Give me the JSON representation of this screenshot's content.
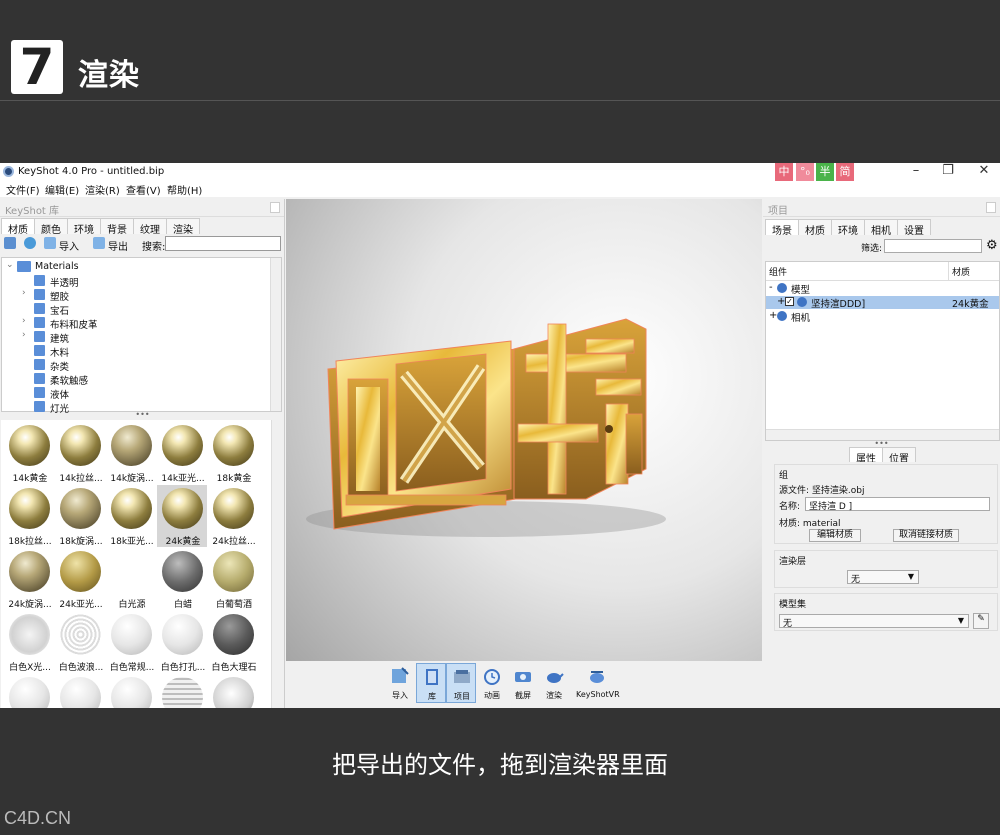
{
  "slide": {
    "step_number": "7",
    "step_title": "渲染",
    "caption": "把导出的文件，拖到渲染器里面",
    "watermark": "C4D.CN"
  },
  "app": {
    "title": "KeyShot 4.0 Pro  - untitled.bip",
    "lang_buttons": [
      "中",
      "°₀",
      "半",
      "简"
    ],
    "lang_colors": [
      "#e8697a",
      "#f08b9b",
      "#4ab34a",
      "#e8697a"
    ],
    "menu": [
      "文件(F)",
      "编辑(E)",
      "渲染(R)",
      "查看(V)",
      "帮助(H)"
    ]
  },
  "library": {
    "header": "KeyShot 库",
    "tabs": [
      "材质",
      "颜色",
      "环境",
      "背景",
      "纹理",
      "渲染"
    ],
    "toolbar": {
      "import": "导入",
      "export": "导出",
      "search_label": "搜索:",
      "search_value": ""
    },
    "tree_root": "Materials",
    "tree_items": [
      {
        "label": "半透明",
        "expandable": false
      },
      {
        "label": "塑胶",
        "expandable": true
      },
      {
        "label": "宝石",
        "expandable": false
      },
      {
        "label": "布料和皮革",
        "expandable": true
      },
      {
        "label": "建筑",
        "expandable": true
      },
      {
        "label": "木料",
        "expandable": false
      },
      {
        "label": "杂类",
        "expandable": false
      },
      {
        "label": "柔软触感",
        "expandable": false
      },
      {
        "label": "液体",
        "expandable": false
      },
      {
        "label": "灯光",
        "expandable": false
      }
    ],
    "materials": [
      {
        "name": "14k黄金",
        "kind": "gold"
      },
      {
        "name": "14k拉丝...",
        "kind": "gold"
      },
      {
        "name": "14k旋涡...",
        "kind": "pattern"
      },
      {
        "name": "14k亚光...",
        "kind": "gold"
      },
      {
        "name": "18k黄金",
        "kind": "gold"
      },
      {
        "name": "18k拉丝...",
        "kind": "gold"
      },
      {
        "name": "18k旋涡...",
        "kind": "pattern"
      },
      {
        "name": "18k亚光...",
        "kind": "gold"
      },
      {
        "name": "24k黄金",
        "kind": "gold",
        "selected": true
      },
      {
        "name": "24k拉丝...",
        "kind": "gold"
      },
      {
        "name": "24k旋涡...",
        "kind": "pattern"
      },
      {
        "name": "24k亚光...",
        "kind": "matte"
      },
      {
        "name": "白光源",
        "kind": "blank"
      },
      {
        "name": "白蜡",
        "kind": "grey"
      },
      {
        "name": "白葡萄酒",
        "kind": "wine"
      },
      {
        "name": "白色X光...",
        "kind": "xray"
      },
      {
        "name": "白色波浪...",
        "kind": "wave"
      },
      {
        "name": "白色常规...",
        "kind": "white"
      },
      {
        "name": "白色打孔...",
        "kind": "white"
      },
      {
        "name": "白色大理石",
        "kind": "marble"
      },
      {
        "name": "",
        "kind": "white"
      },
      {
        "name": "",
        "kind": "white"
      },
      {
        "name": "",
        "kind": "white"
      },
      {
        "name": "",
        "kind": "stripe"
      },
      {
        "name": "",
        "kind": "sparkle"
      }
    ]
  },
  "dock": [
    {
      "label": "导入",
      "active": false
    },
    {
      "label": "库",
      "active": true
    },
    {
      "label": "项目",
      "active": true
    },
    {
      "label": "动画",
      "active": false
    },
    {
      "label": "截屏",
      "active": false
    },
    {
      "label": "渲染",
      "active": false
    },
    {
      "label": "KeyShotVR",
      "active": false
    }
  ],
  "project": {
    "header": "项目",
    "tabs": [
      "场景",
      "材质",
      "环境",
      "相机",
      "设置"
    ],
    "filter_label": "筛选:",
    "columns": {
      "component": "组件",
      "material": "材质"
    },
    "tree": [
      {
        "label": "模型",
        "level": 0,
        "toggle": "-",
        "material": ""
      },
      {
        "label": "坚持渲DDD]",
        "level": 1,
        "toggle": "+",
        "material": "24k黄金",
        "selected": true
      },
      {
        "label": "相机",
        "level": 0,
        "toggle": "+",
        "material": ""
      }
    ],
    "subtabs": [
      "属性",
      "位置"
    ],
    "group_label": "组",
    "source_file": "源文件: 坚持渲染.obj",
    "name_label": "名称:",
    "name_value": "坚持渲  D  ]",
    "material_text": "材质: material",
    "edit_material": "编辑材质",
    "unlink_material": "取消链接材质",
    "render_layer_label": "渲染层",
    "render_layer_value": "无",
    "model_set_label": "模型集",
    "model_set_value": "无"
  }
}
